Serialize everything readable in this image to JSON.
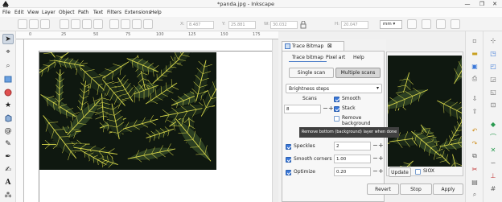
{
  "window": {
    "title": "*panda.jpg - Inkscape",
    "minimize_glyph": "—",
    "restore_glyph": "❐",
    "close_glyph": "✕"
  },
  "menu": [
    "File",
    "Edit",
    "View",
    "Layer",
    "Object",
    "Path",
    "Text",
    "Filters",
    "Extensions",
    "Help"
  ],
  "tool_controls": {
    "x_label": "X:",
    "x_value": "8.487",
    "y_label": "Y:",
    "y_value": "25.881",
    "w_label": "W:",
    "w_value": "30.032",
    "h_label": "H:",
    "h_value": "20.047",
    "unit": "mm"
  },
  "ruler_labels": [
    "0",
    "25",
    "50",
    "75",
    "100",
    "125",
    "150",
    "175"
  ],
  "trace_bitmap": {
    "panel_title": "Trace Bitmap",
    "close_glyph": "⊠",
    "tabs": [
      "Trace bitmap",
      "Pixel art",
      "Help"
    ],
    "scan_modes": [
      "Single scan",
      "Multiple scans"
    ],
    "detection_mode": "Brightness steps",
    "scans_label": "Scans",
    "scans_value": "8",
    "smooth_label": "Smooth",
    "stack_label": "Stack",
    "remove_background_label": "Remove background",
    "tooltip": "Remove bottom (background) layer when done",
    "speckles_label": "Speckles",
    "speckles_value": "2",
    "smooth_corners_label": "Smooth corners",
    "smooth_corners_value": "1.00",
    "optimize_label": "Optimize",
    "optimize_value": "0.20",
    "update_label": "Update",
    "siox_label": "SIOX",
    "revert_label": "Revert",
    "stop_label": "Stop",
    "apply_label": "Apply",
    "checks": {
      "smooth": true,
      "stack": true,
      "remove_background": false,
      "speckles": true,
      "smooth_corners": true,
      "optimize": true,
      "siox": false
    }
  },
  "colors": {
    "accent": "#3b78d8",
    "leaf_dark": "#1c2a18",
    "leaf_vein": "#d9d84a"
  }
}
